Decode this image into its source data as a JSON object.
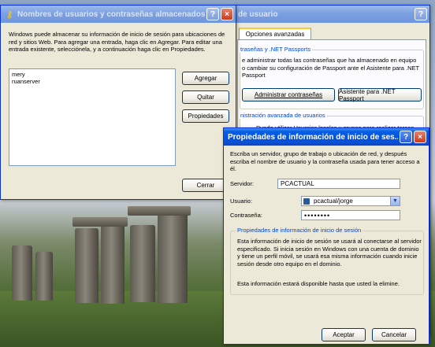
{
  "win1": {
    "title": "Nombres de usuarios y contraseñas almacenados",
    "help_btn": "?",
    "close_btn": "×",
    "description": "Windows puede almacenar su información de inicio de sesión para ubicaciones de red y sitios Web. Para agregar una entrada, haga clic en Agregar. Para editar una entrada existente, selecciónela, y a continuación haga clic en Propiedades.",
    "entries": [
      "mery",
      "ruanserver"
    ],
    "add_label": "Agregar",
    "remove_label": "Quitar",
    "props_label": "Propiedades",
    "close_label": "Cerrar"
  },
  "win2": {
    "title": "de usuario",
    "help_btn": "?",
    "tab_advanced": "Opciones avanzadas",
    "group1_title": "traseñas y .NET Passports",
    "group1_text": "e administrar todas las contraseñas que ha almacenado en equipo o cambiar su configuración de Passport ante el Asistente para .NET Passport",
    "manage_label": "Administrar contraseñas",
    "passport_label": "Asistente para .NET Passport",
    "group2_title": "nistración avanzada de usuarios",
    "group2_text": "Puede utilizar Usuarios locales y grupos para realizar tareas"
  },
  "win3": {
    "title": "Propiedades de información de inicio de ses...",
    "help_btn": "?",
    "close_btn": "×",
    "intro": "Escriba un servidor, grupo de trabajo o ubicación de red, y después escriba el nombre de usuario y la contraseña usada para tener acceso a él.",
    "server_label": "Servidor:",
    "server_value": "PCACTUAL",
    "user_label": "Usuario:",
    "user_value": "pcactual/jorge",
    "password_label": "Contraseña:",
    "password_value": "••••••••",
    "group_title": "Propiedades de información de inicio de sesión",
    "info1": "Esta información de inicio de sesión se usará al conectarse al servidor especificado. Si inicia sesión en Windows con una cuenta de dominio y tiene un perfil móvil, se usará esa misma información cuando inicie sesión desde otro equipo en el dominio.",
    "info2": "Esta información estará disponible hasta que usted la elimine.",
    "ok_label": "Aceptar",
    "cancel_label": "Cancelar"
  }
}
